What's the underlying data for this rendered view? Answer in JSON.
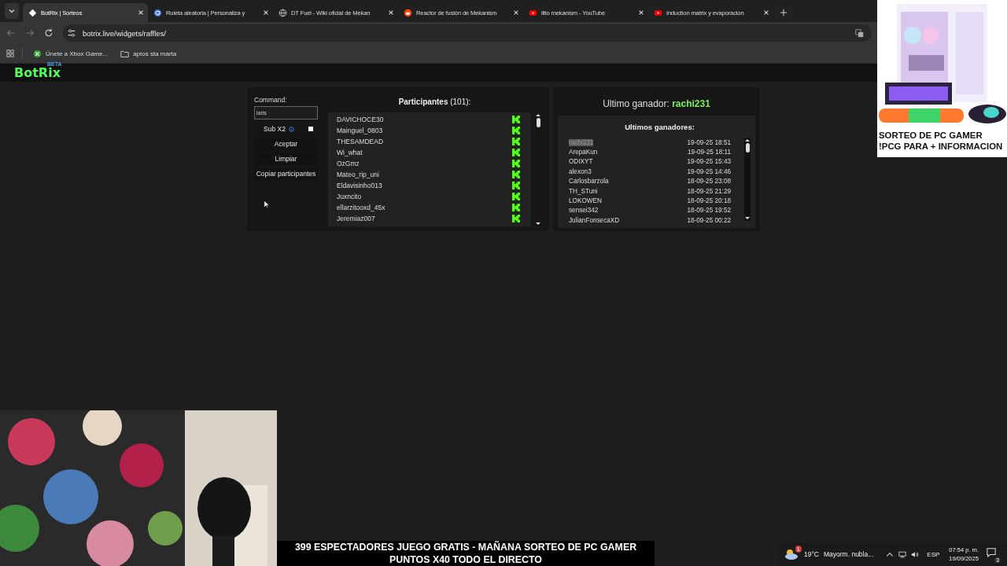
{
  "browser": {
    "tabs": [
      {
        "title": "BotRix | Sorteos",
        "selected": true,
        "kind": "botrix"
      },
      {
        "title": "Ruleta aleatoria | Personaliza y",
        "selected": false,
        "kind": "wordpress"
      },
      {
        "title": "DT Fuel - Wiki oficial de Mekan",
        "selected": false,
        "kind": "globe"
      },
      {
        "title": "Reactor de fusión de Mekanism",
        "selected": false,
        "kind": "reddit"
      },
      {
        "title": "litio mekanism - YouTube",
        "selected": false,
        "kind": "youtube"
      },
      {
        "title": "Induction matrix y evaporacion",
        "selected": false,
        "kind": "youtube"
      }
    ],
    "address": "botrix.live/widgets/raffles/",
    "bookmarks": [
      {
        "label": "Únete a Xbox Game...",
        "kind": "xbox"
      },
      {
        "label": "aptos sta marta",
        "kind": "folder"
      }
    ]
  },
  "site": {
    "logo": "BotRix",
    "badge": "BETA"
  },
  "controls": {
    "command_label": "Command:",
    "command_value": "laris",
    "sub_label": "Sub X2",
    "sub_checked": false,
    "buttons": [
      "Aceptar",
      "Limpiar",
      "Copiar participantes"
    ]
  },
  "participants": {
    "heading": "**Participantes** (101):",
    "names": [
      "DAVICHOCE30",
      "Mainguel_0803",
      "THESAMDEAD",
      "Wi_what",
      "OzGmz",
      "Mateo_rip_uni",
      "Eldavisinho013",
      "Juxncito",
      "ellarzitooxd_45x",
      "Jeremiaz007"
    ]
  },
  "winner": {
    "label": "Ultimo ganador: ",
    "name": "rachi231"
  },
  "winners": {
    "heading": "Ultimos ganadores:",
    "rows": [
      {
        "name": "rachi231",
        "date": "19-09-25 18:51",
        "highlighted": true
      },
      {
        "name": "ArepaKun",
        "date": "19-09-25 18:11",
        "highlighted": false
      },
      {
        "name": "ODIXYT",
        "date": "19-09-25 15:43",
        "highlighted": false
      },
      {
        "name": "alexon3",
        "date": "19-09-25 14:46",
        "highlighted": false
      },
      {
        "name": "Carlosbarzola",
        "date": "18-09-25 23:08",
        "highlighted": false
      },
      {
        "name": "TH_STuni",
        "date": "18-09-25 21:29",
        "highlighted": false
      },
      {
        "name": "LOKOWEN",
        "date": "18-09-25 20:18",
        "highlighted": false
      },
      {
        "name": "sensei342",
        "date": "18-09-25 19:52",
        "highlighted": false
      },
      {
        "name": "JulianFonsecaXD",
        "date": "18-09-25 00:22",
        "highlighted": false
      }
    ]
  },
  "ad": {
    "lines": [
      "SORTEO DE PC GAMER",
      "!PCG PARA + INFORMACION"
    ]
  },
  "overlay": {
    "lines": [
      "399 ESPECTADORES JUEGO GRATIS - MAÑANA SORTEO DE PC GAMER",
      "PUNTOS X40 TODO EL DIRECTO"
    ]
  },
  "taskbar": {
    "weather_badge": "1",
    "temperature": "19°C",
    "weather": "Mayorm. nubla...",
    "language": "ESP",
    "time": "07:54 p. m.",
    "date": "19/09/2025",
    "notifications": "3"
  }
}
